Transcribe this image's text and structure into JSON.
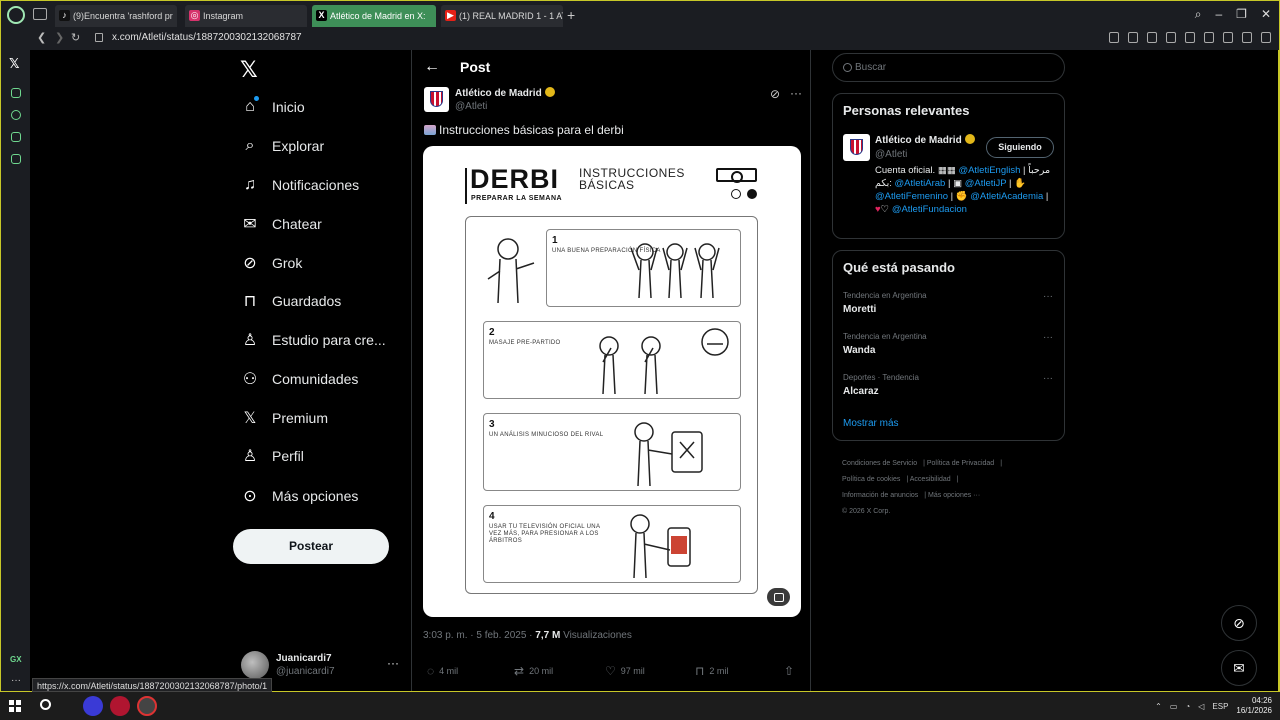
{
  "browser": {
    "tabs": [
      {
        "label": "(9)Encuentra 'rashford pr",
        "favicon": "tiktok-icon"
      },
      {
        "label": "Instagram",
        "favicon": "instagram-icon"
      },
      {
        "label": "Atlético de Madrid en X:",
        "favicon": "x-icon",
        "active": true
      },
      {
        "label": "(1) REAL MADRID 1 - 1 ATL",
        "favicon": "youtube-icon"
      }
    ],
    "url": "x.com/Atleti/status/1887200302132068787",
    "status_url": "https://x.com/Atleti/status/1887200302132068787/photo/1",
    "sidebar_label_gx": "GX"
  },
  "nav": {
    "items": [
      {
        "label": "Inicio",
        "icon": "home-icon"
      },
      {
        "label": "Explorar",
        "icon": "search-icon"
      },
      {
        "label": "Notificaciones",
        "icon": "bell-icon"
      },
      {
        "label": "Chatear",
        "icon": "mail-icon"
      },
      {
        "label": "Grok",
        "icon": "grok-icon"
      },
      {
        "label": "Guardados",
        "icon": "bookmark-icon"
      },
      {
        "label": "Estudio para cre...",
        "icon": "flask-icon"
      },
      {
        "label": "Comunidades",
        "icon": "communities-icon"
      },
      {
        "label": "Premium",
        "icon": "x-icon"
      },
      {
        "label": "Perfil",
        "icon": "profile-icon"
      },
      {
        "label": "Más opciones",
        "icon": "more-circle-icon"
      }
    ],
    "post_button": "Postear",
    "account": {
      "name": "Juanicardi7",
      "handle": "@juanicardi7"
    }
  },
  "post": {
    "heading": "Post",
    "author_name": "Atlético de Madrid",
    "author_handle": "@Atleti",
    "text": "Instrucciones básicas para el derbi",
    "image": {
      "title": "DERBI",
      "subtitle": "INSTRUCCIONES BÁSICAS",
      "prep": "PREPARAR LA SEMANA",
      "steps": [
        {
          "num": "1",
          "desc": "UNA BUENA PREPARACIÓN FÍSICA"
        },
        {
          "num": "2",
          "desc": "MASAJE PRE-PARTIDO"
        },
        {
          "num": "3",
          "desc": "UN ANÁLISIS MINUCIOSO DEL RIVAL"
        },
        {
          "num": "4",
          "desc": "USAR TU TELEVISIÓN OFICIAL UNA VEZ MÁS, PARA PRESIONAR A LOS ÁRBITROS"
        }
      ]
    },
    "timestamp": "3:03 p. m. · 5 feb. 2025 ·",
    "views_count": "7,7 M",
    "views_label": "Visualizaciones",
    "replies": "4 mil",
    "reposts": "20 mil",
    "likes": "97 mil",
    "bookmarks": "2 mil"
  },
  "right": {
    "search_placeholder": "Buscar",
    "relevant_title": "Personas relevantes",
    "relevant": {
      "name": "Atlético de Madrid",
      "handle": "@Atleti",
      "follow_label": "Siguiendo",
      "bio_1": "Cuenta oficial.",
      "bio_link_en": "@AtletiEnglish",
      "bio_ar_text": "مرحباً بكم:",
      "bio_link_ar": "@AtletiArab",
      "bio_link_jp": "@AtletiJP",
      "bio_link_fem": "@AtletiFemenino",
      "bio_link_acad": "@AtletiAcademia",
      "bio_link_fund": "@AtletiFundacion"
    },
    "trends_title": "Qué está pasando",
    "trends": [
      {
        "context": "Tendencia en Argentina",
        "name": "Moretti"
      },
      {
        "context": "Tendencia en Argentina",
        "name": "Wanda"
      },
      {
        "context": "Deportes · Tendencia",
        "name": "Alcaraz"
      }
    ],
    "show_more": "Mostrar más",
    "footer": {
      "terms": "Condiciones de Servicio",
      "privacy": "Política de Privacidad",
      "cookies": "Política de cookies",
      "accessibility": "Accesibilidad",
      "ads": "Información de anuncios",
      "more": "Más opciones ···",
      "copyright": "© 2026 X Corp."
    }
  },
  "taskbar": {
    "lang": "ESP",
    "time": "04:26",
    "date": "16/1/2026"
  },
  "colors": {
    "accent": "#1d9bf0",
    "opera_frame": "#c7c728",
    "active_tab": "#3e8f58"
  }
}
